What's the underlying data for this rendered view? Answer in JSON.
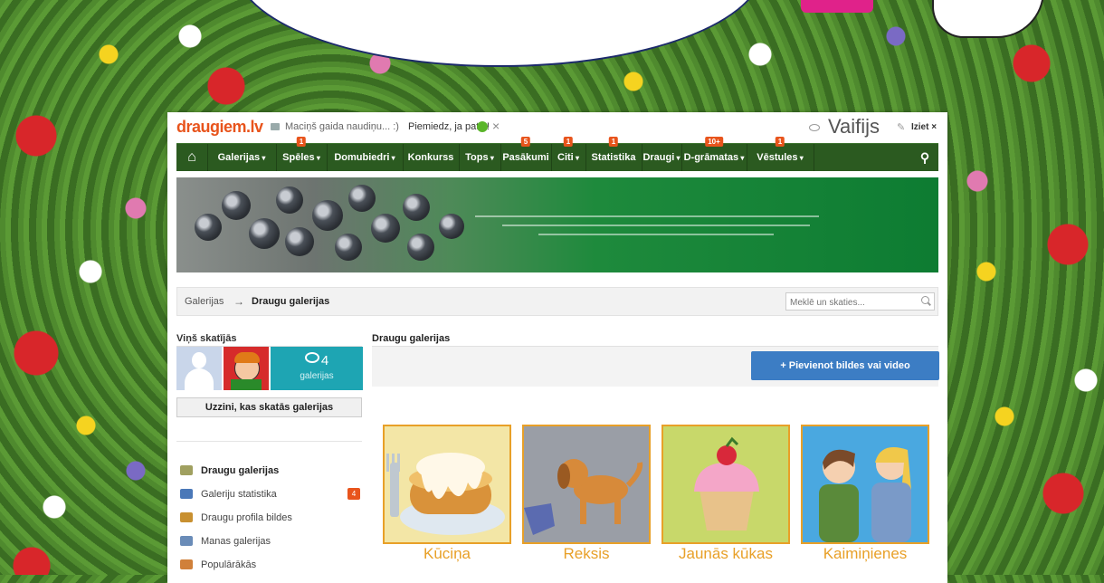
{
  "header": {
    "logo": "draugiem.lv",
    "status_text": "Maciņš gaida naudiņu... :)",
    "like_text": "Piemiedz, ja patīk!",
    "username": "Vaifijs",
    "logout": "Iziet ×"
  },
  "nav": {
    "items": [
      {
        "label": "Galerijas",
        "caret": true,
        "badge": ""
      },
      {
        "label": "Spēles",
        "caret": true,
        "badge": "1"
      },
      {
        "label": "Domubiedri",
        "caret": true,
        "badge": ""
      },
      {
        "label": "Konkurss",
        "caret": false,
        "badge": ""
      },
      {
        "label": "Tops",
        "caret": true,
        "badge": ""
      },
      {
        "label": "Pasākumi",
        "caret": false,
        "badge": "5"
      },
      {
        "label": "Citi",
        "caret": true,
        "badge": "1"
      },
      {
        "label": "Statistika",
        "caret": false,
        "badge": "1"
      },
      {
        "label": "Draugi",
        "caret": true,
        "badge": ""
      },
      {
        "label": "D-grāmatas",
        "caret": true,
        "badge": "10+"
      },
      {
        "label": "Vēstules",
        "caret": true,
        "badge": "1"
      }
    ]
  },
  "breadcrumb": {
    "root": "Galerijas",
    "arrow": "→",
    "current": "Draugu galerijas"
  },
  "search": {
    "placeholder": "Meklē un skaties..."
  },
  "sidebar": {
    "viewers_title": "Viņš skatījās",
    "views_count": "4",
    "views_label": "galerijas",
    "who_button": "Uzzini, kas skatās galerijas",
    "menu": [
      {
        "label": "Draugu galerijas",
        "active": true,
        "badge": "",
        "color": "#a0a060"
      },
      {
        "label": "Galeriju statistika",
        "active": false,
        "badge": "4",
        "color": "#4a78b8"
      },
      {
        "label": "Draugu profila bildes",
        "active": false,
        "badge": "",
        "color": "#c89030"
      },
      {
        "label": "Manas galerijas",
        "active": false,
        "badge": "",
        "color": "#6a8cb8"
      },
      {
        "label": "Populārākās",
        "active": false,
        "badge": "",
        "color": "#d0803a"
      }
    ]
  },
  "content": {
    "title": "Draugu galerijas",
    "add_button": "+ Pievienot bildes vai video",
    "galleries": [
      {
        "label": "Kūciņa"
      },
      {
        "label": "Reksis"
      },
      {
        "label": "Jaunās kūkas"
      },
      {
        "label": "Kaimiņienes"
      }
    ]
  },
  "colors": {
    "nav_bg": "#2b5a20",
    "accent_orange": "#e8541c",
    "tile_border": "#e8a028",
    "button_blue": "#3c7dc4",
    "views_teal": "#1ea5b3"
  }
}
